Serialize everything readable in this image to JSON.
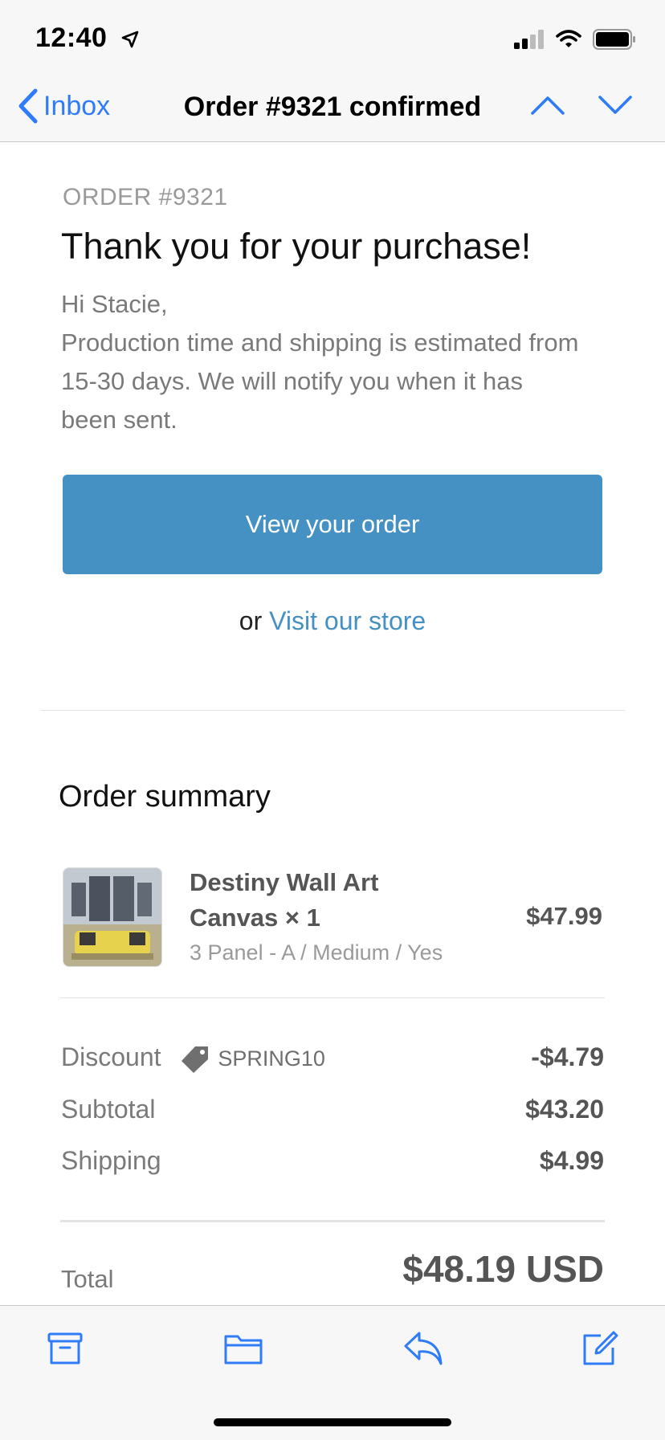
{
  "status": {
    "time": "12:40"
  },
  "nav": {
    "back_label": "Inbox",
    "title": "Order #9321 confirmed"
  },
  "email": {
    "order_label": "ORDER #9321",
    "headline": "Thank you for your purchase!",
    "greeting": "Hi Stacie,",
    "message": "Production time and shipping is estimated from 15-30 days. We will notify you when it has been sent.",
    "view_button": "View your order",
    "or_text": "or ",
    "store_link": "Visit our store"
  },
  "summary": {
    "title": "Order summary",
    "item": {
      "name": "Destiny Wall Art Canvas × 1",
      "variant": "3 Panel - A / Medium / Yes",
      "price": "$47.99"
    },
    "discount": {
      "label": "Discount",
      "code": "SPRING10",
      "value": "-$4.79"
    },
    "subtotal": {
      "label": "Subtotal",
      "value": "$43.20"
    },
    "shipping": {
      "label": "Shipping",
      "value": "$4.99"
    },
    "total": {
      "label": "Total",
      "value": "$48.19 USD"
    }
  },
  "colors": {
    "accent": "#2f7cf6",
    "button": "#4591c4",
    "link": "#4591c4"
  }
}
